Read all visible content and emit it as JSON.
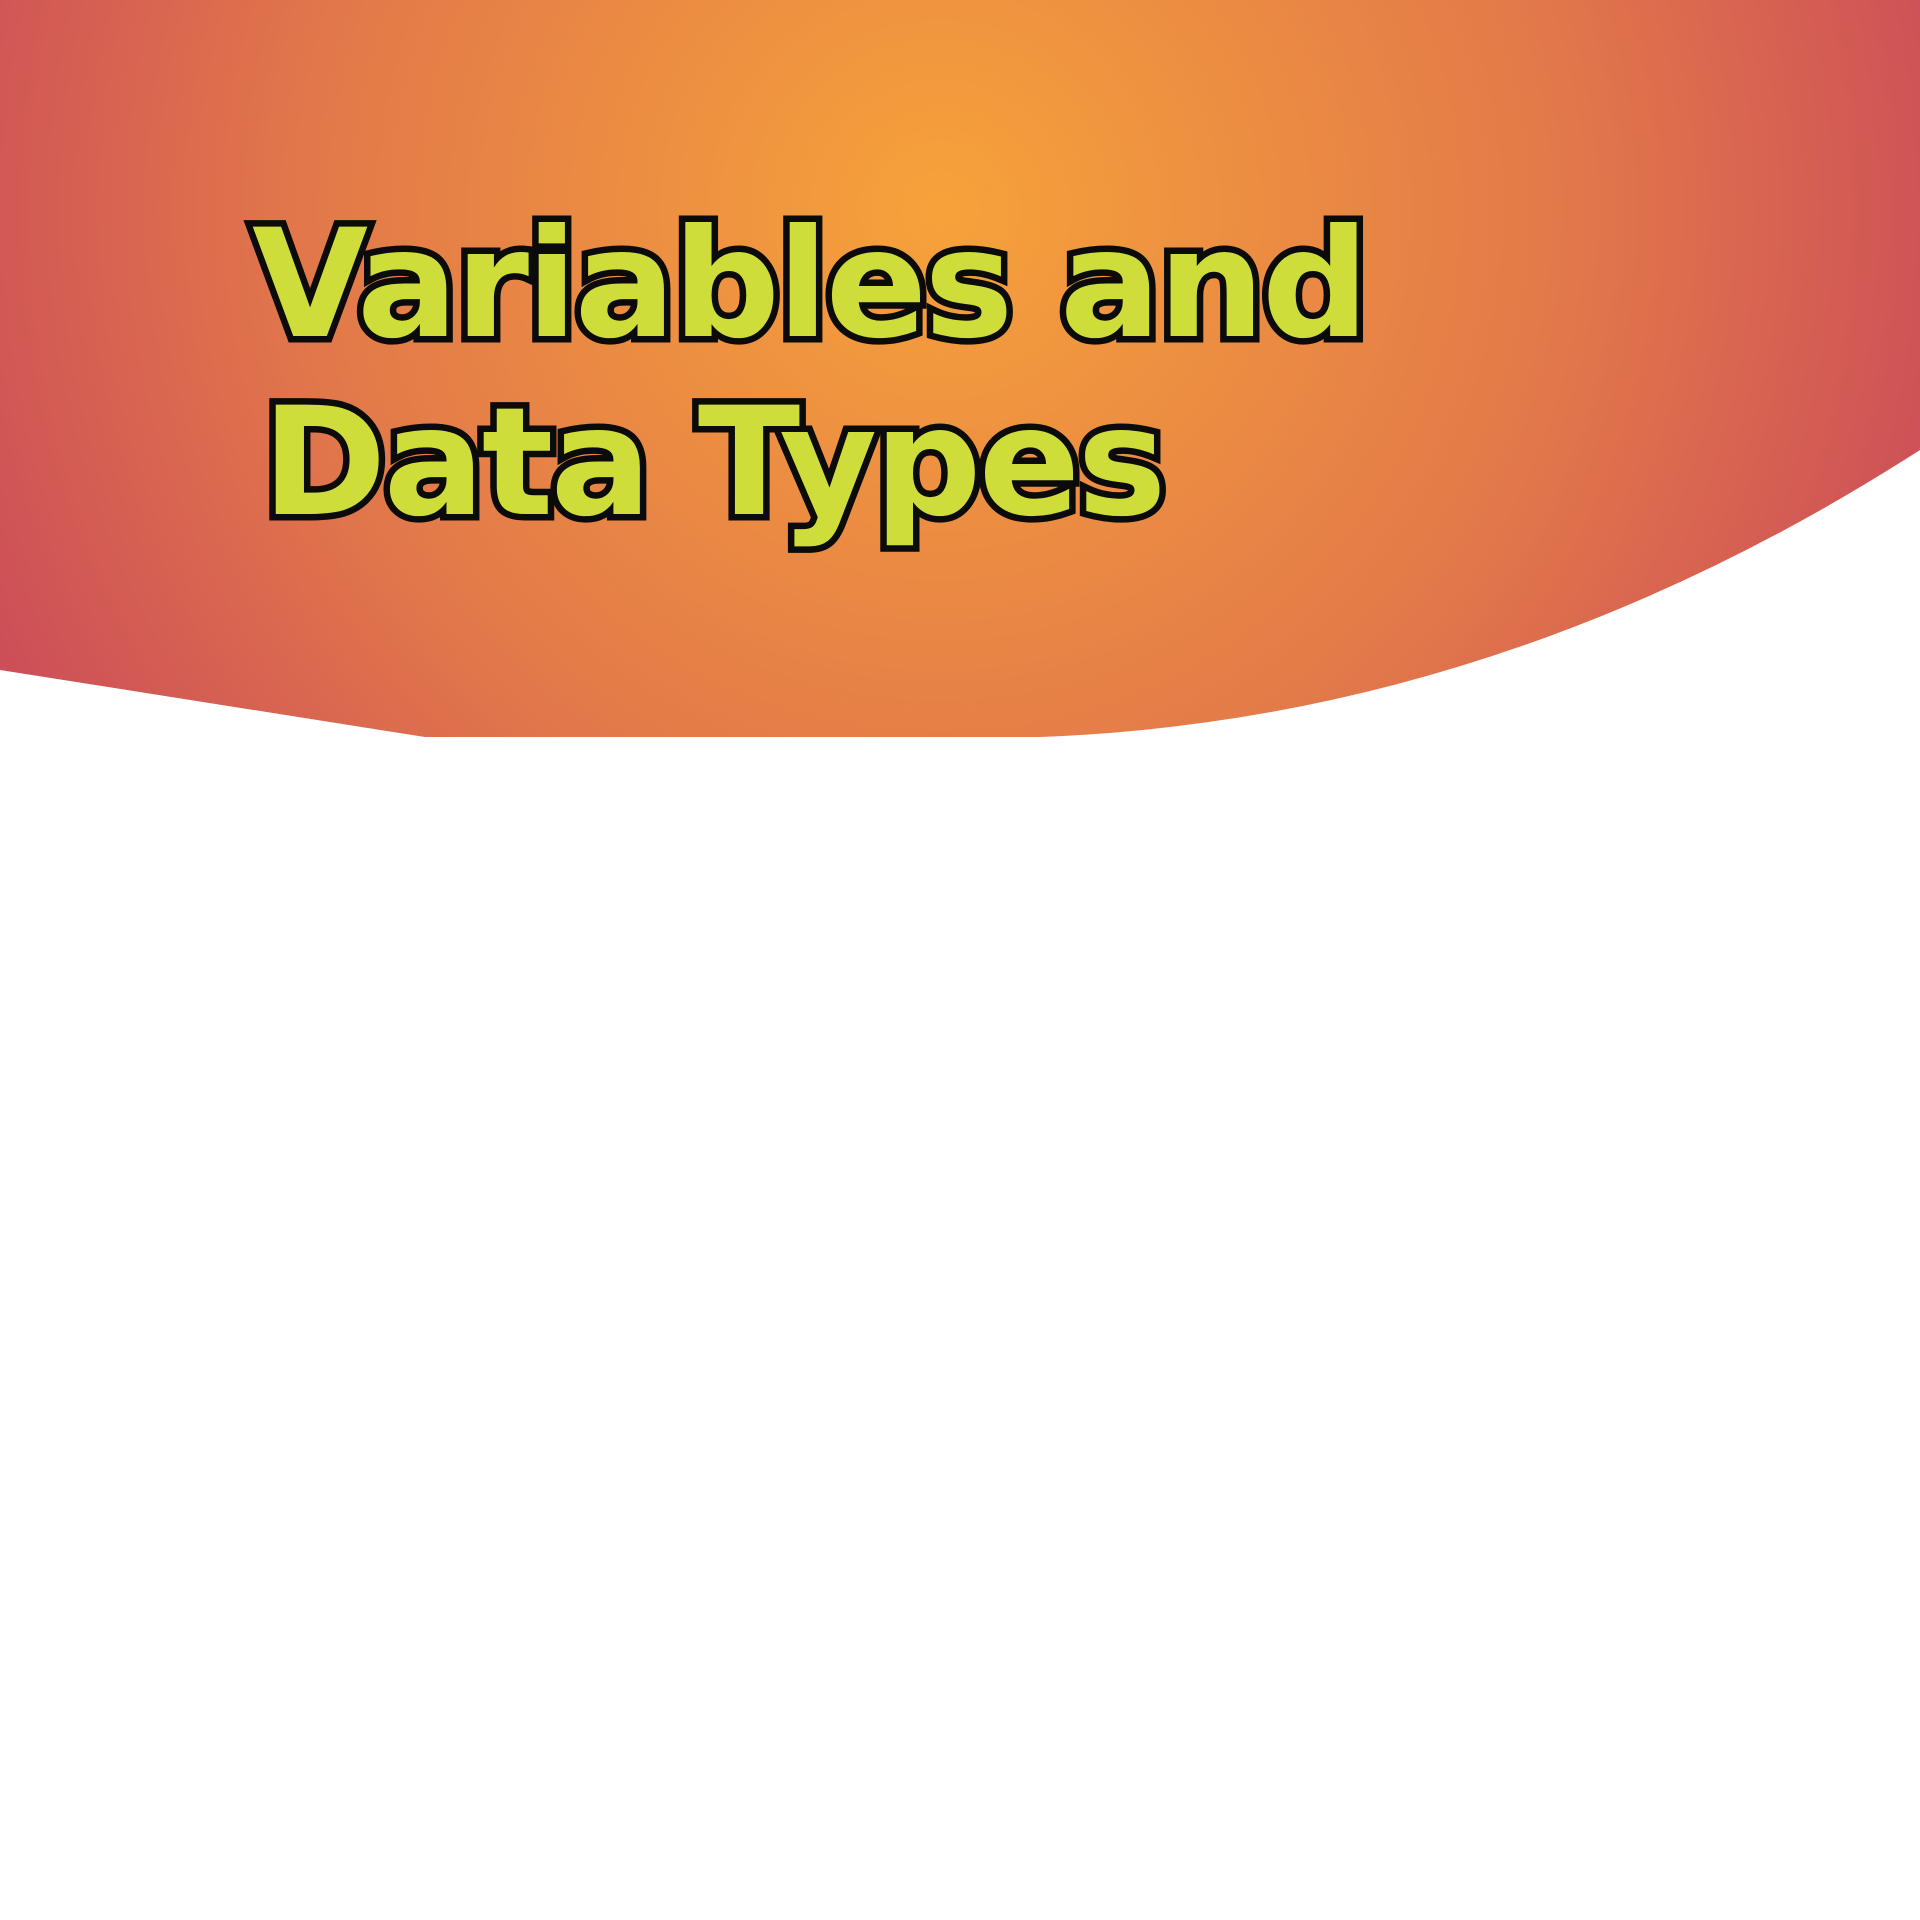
{
  "slide": {
    "title_line_1": "Variables and",
    "title_line_2": "Data Types"
  },
  "colors": {
    "title_fill": "#cfdd3a",
    "title_outline": "#0b0b0b",
    "gradient_center": "#f6a23a",
    "gradient_mid": "#e2784a",
    "gradient_edge": "#c6435c",
    "background": "#ffffff"
  }
}
